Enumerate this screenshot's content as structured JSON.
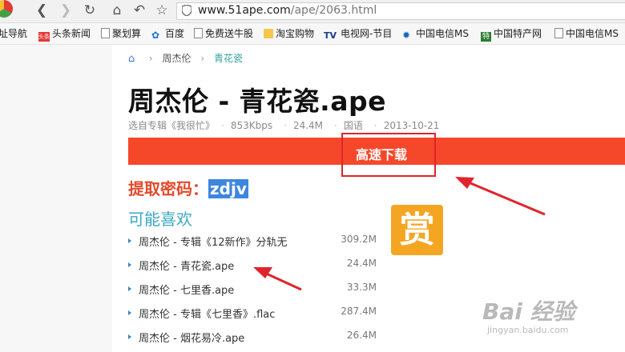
{
  "browser": {
    "url_host": "www.51ape.com",
    "url_path": "/ape/2063.html"
  },
  "bookmarks": [
    "址导航",
    "头条新闻",
    "聚划算",
    "百度",
    "免费送牛股",
    "淘宝购物",
    "电视网-节目",
    "中国电信MS",
    "中国特产网",
    "中国电信MS"
  ],
  "bookmark_icons": {
    "toutiao": "头条",
    "tv": "TV",
    "te": "特"
  },
  "breadcrumb": {
    "level1": "周杰伦",
    "current": "青花瓷"
  },
  "song": {
    "title": "周杰伦 - 青花瓷.ape",
    "album": "选自专辑《我很忙》",
    "bitrate": "853Kbps",
    "size": "24.4M",
    "language": "国语",
    "date": "2013-10-21"
  },
  "download": {
    "label": "高速下载"
  },
  "extract": {
    "label": "提取密码：",
    "code": "zdjv"
  },
  "related": {
    "heading": "可能喜欢",
    "items": [
      {
        "name": "周杰伦 - 专辑《12新作》分轨无",
        "size": "309.2M"
      },
      {
        "name": "周杰伦 - 青花瓷.ape",
        "size": "24.4M"
      },
      {
        "name": "周杰伦 - 七里香.ape",
        "size": "33.3M"
      },
      {
        "name": "周杰伦 - 专辑《七里香》.flac",
        "size": "287.4M"
      },
      {
        "name": "周杰伦 - 烟花易冷.ape",
        "size": "26.4M"
      }
    ]
  },
  "reward": {
    "label": "赏"
  },
  "watermark": {
    "brand": "Bai 经验",
    "url": "jingyan.baidu.com"
  },
  "colors": {
    "download_bar": "#f5482b",
    "highlight_box": "#e0242b",
    "code_bg": "#3d86df",
    "related_heading": "#3aa8c1",
    "reward_bg": "#f4a623"
  }
}
